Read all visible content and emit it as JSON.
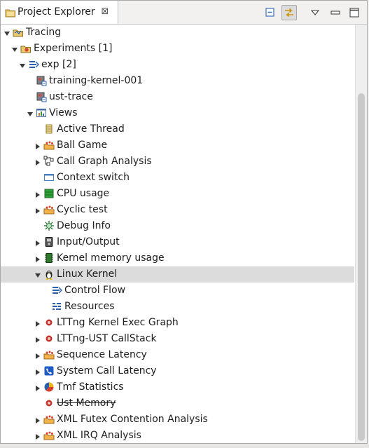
{
  "view": {
    "tab_title": "Project Explorer",
    "tab_close_glyph": "⊠"
  },
  "toolbar": {
    "buttons": [
      {
        "name": "collapse-all-icon"
      },
      {
        "name": "link-with-editor-icon",
        "pressed": true
      },
      {
        "name": "view-menu-icon"
      },
      {
        "name": "minimize-icon"
      },
      {
        "name": "maximize-icon"
      }
    ]
  },
  "tree": {
    "items": [
      {
        "label": "Tracing",
        "level": 0,
        "twisty": "expanded",
        "icon": "tracing-project-icon"
      },
      {
        "label": "Experiments [1]",
        "level": 1,
        "twisty": "expanded",
        "icon": "experiments-folder-icon"
      },
      {
        "label": "exp [2]",
        "level": 2,
        "twisty": "expanded",
        "icon": "experiment-icon"
      },
      {
        "label": "training-kernel-001",
        "level": 3,
        "twisty": "none",
        "icon": "trace-icon"
      },
      {
        "label": "ust-trace",
        "level": 3,
        "twisty": "none",
        "icon": "trace-icon"
      },
      {
        "label": "Views",
        "level": 3,
        "twisty": "expanded",
        "icon": "views-icon"
      },
      {
        "label": "Active Thread",
        "level": 4,
        "twisty": "none",
        "icon": "active-thread-icon"
      },
      {
        "label": "Ball Game",
        "level": 4,
        "twisty": "collapsed",
        "icon": "xml-analysis-icon"
      },
      {
        "label": "Call Graph Analysis",
        "level": 4,
        "twisty": "collapsed",
        "icon": "call-graph-icon"
      },
      {
        "label": "Context switch",
        "level": 4,
        "twisty": "none",
        "icon": "window-icon"
      },
      {
        "label": "CPU usage",
        "level": 4,
        "twisty": "collapsed",
        "icon": "cpu-usage-icon"
      },
      {
        "label": "Cyclic test",
        "level": 4,
        "twisty": "collapsed",
        "icon": "xml-analysis-icon"
      },
      {
        "label": "Debug Info",
        "level": 4,
        "twisty": "none",
        "icon": "debug-gear-icon"
      },
      {
        "label": "Input/Output",
        "level": 4,
        "twisty": "collapsed",
        "icon": "disk-icon"
      },
      {
        "label": "Kernel memory usage",
        "level": 4,
        "twisty": "collapsed",
        "icon": "memory-icon"
      },
      {
        "label": "Linux Kernel",
        "level": 4,
        "twisty": "expanded",
        "icon": "tux-icon",
        "selected": true
      },
      {
        "label": "Control Flow",
        "level": 5,
        "twisty": "none",
        "icon": "control-flow-icon"
      },
      {
        "label": "Resources",
        "level": 5,
        "twisty": "none",
        "icon": "resources-icon"
      },
      {
        "label": "LTTng Kernel Exec Graph",
        "level": 4,
        "twisty": "collapsed",
        "icon": "lttng-icon"
      },
      {
        "label": "LTTng-UST CallStack",
        "level": 4,
        "twisty": "collapsed",
        "icon": "lttng-icon"
      },
      {
        "label": "Sequence Latency",
        "level": 4,
        "twisty": "collapsed",
        "icon": "xml-analysis-icon"
      },
      {
        "label": "System Call Latency",
        "level": 4,
        "twisty": "collapsed",
        "icon": "phone-icon"
      },
      {
        "label": "Tmf Statistics",
        "level": 4,
        "twisty": "collapsed",
        "icon": "pie-chart-icon"
      },
      {
        "label": "Ust Memory",
        "level": 4,
        "twisty": "none",
        "icon": "lttng-icon",
        "strikethrough": true
      },
      {
        "label": "XML Futex Contention Analysis",
        "level": 4,
        "twisty": "collapsed",
        "icon": "xml-analysis-icon"
      },
      {
        "label": "XML IRQ Analysis",
        "level": 4,
        "twisty": "collapsed",
        "icon": "xml-analysis-icon"
      }
    ]
  },
  "colors": {
    "selection": "#dcdcdc",
    "tab_active": "#ffffff",
    "chrome": "#f2f1f0"
  }
}
